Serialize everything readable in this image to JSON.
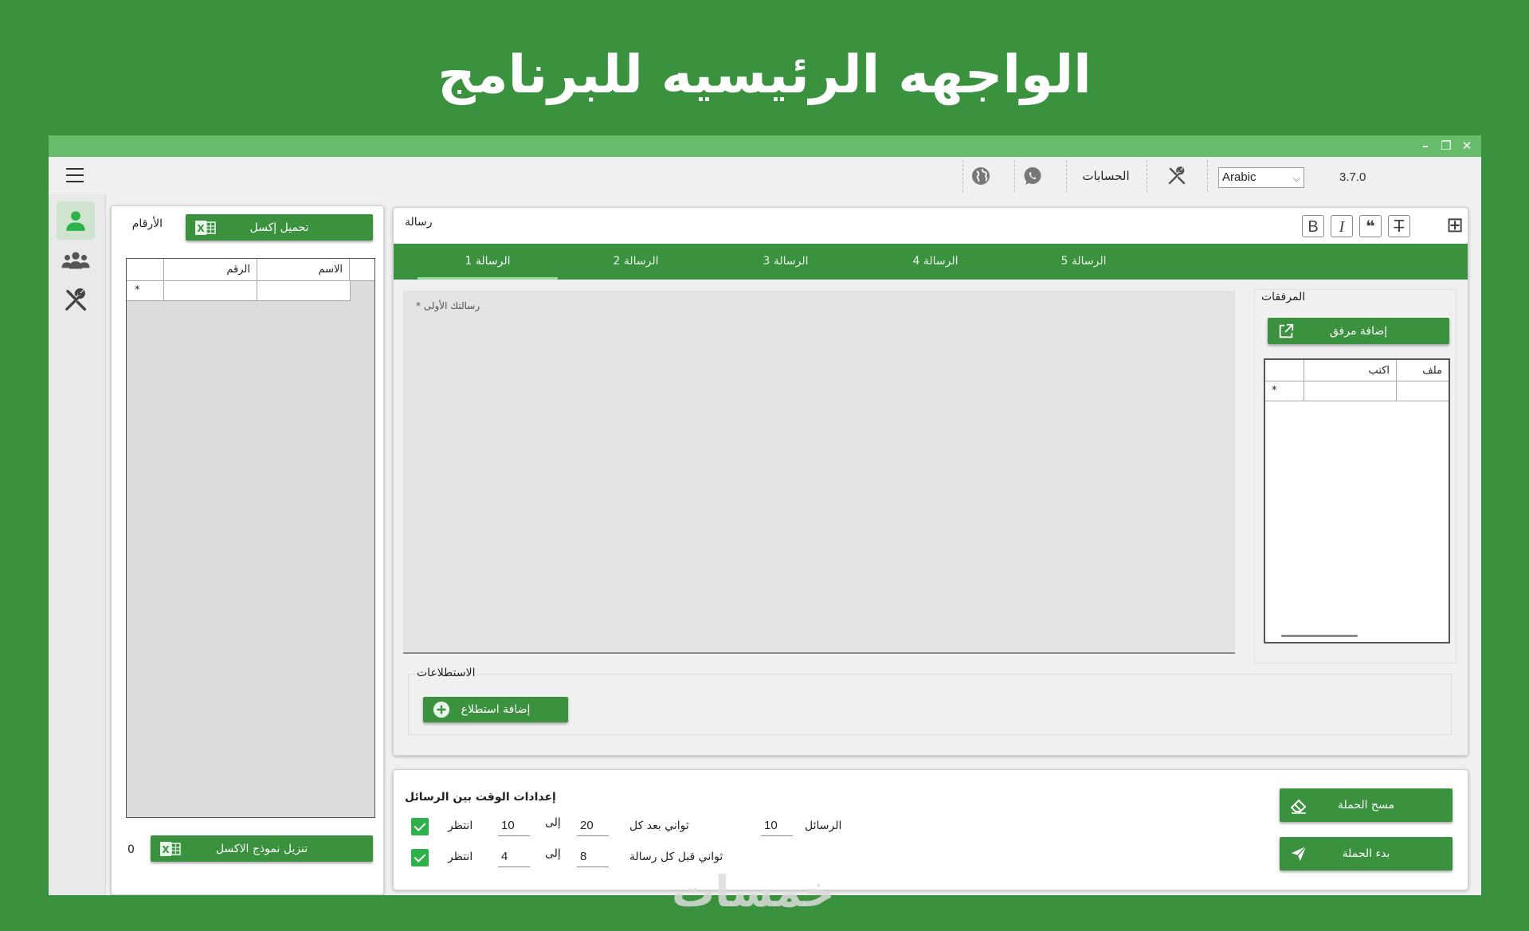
{
  "hero_title": "الواجهه الرئيسيه للبرنامج",
  "window_buttons": {
    "minimize": "–",
    "restore": "❐",
    "close": "✕"
  },
  "toolbar": {
    "accounts_label": "الحسابات",
    "language": "Arabic",
    "version": "3.7.0",
    "icons": [
      "menu-icon",
      "globe-icon",
      "whatsapp-icon",
      "tools-icon"
    ]
  },
  "sidebar": {
    "items": [
      "user-icon",
      "group-icon",
      "tools-icon"
    ]
  },
  "numbers_panel": {
    "title": "الأرقام",
    "load_excel_button": "تحميل إكسل",
    "columns": [
      "الاسم",
      "الرقم"
    ],
    "new_row_marker": "*",
    "count": "0",
    "download_template_button": "تنزيل نموذج الاكسل"
  },
  "message_panel": {
    "title": "رسالة",
    "format_buttons": [
      "B",
      "I",
      "❝",
      "T̶"
    ],
    "add_button": "⊞",
    "tabs": [
      "الرسالة 1",
      "الرسالة 2",
      "الرسالة 3",
      "الرسالة 4",
      "الرسالة 5"
    ],
    "active_tab": 0,
    "placeholder": "رسالتك الأولى *",
    "attachments": {
      "title": "المرفقات",
      "add_button": "إضافة مرفق",
      "columns": [
        "ملف",
        "اكتب"
      ],
      "new_row_marker": "*"
    },
    "polls": {
      "title": "الاستطلاعات",
      "add_button": "إضافة استطلاع"
    }
  },
  "timing": {
    "title": "إعدادات الوقت بين الرسائل",
    "wait_label": "انتظر",
    "to_label": "إلى",
    "row1": {
      "from": "10",
      "to": "20",
      "suffix": "ثواني بعد كل",
      "messages": "10",
      "messages_label": "الرسائل",
      "checked": true
    },
    "row2": {
      "from": "4",
      "to": "8",
      "suffix": "ثواني قبل كل رسالة",
      "checked": true
    },
    "clear_button": "مسح الحملة",
    "start_button": "بدء الحملة"
  },
  "watermark": "خمسات",
  "colors": {
    "brand_green": "#3a923f",
    "title_bar": "#67bd6b",
    "check_green": "#2db24a"
  }
}
